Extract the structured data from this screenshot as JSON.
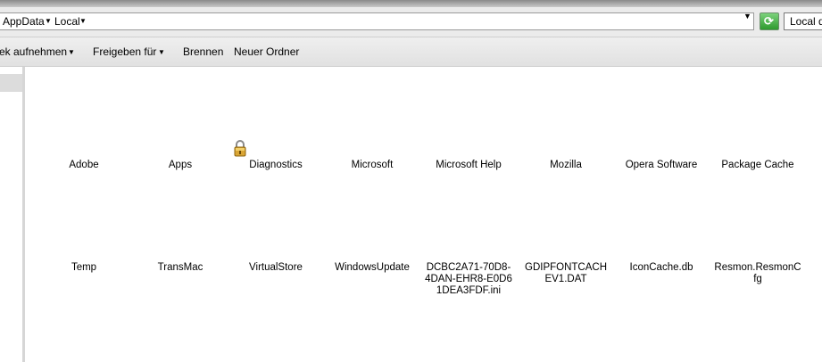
{
  "address": {
    "crumbs": [
      "AppData",
      "Local"
    ],
    "search_text": "Local du",
    "refresh_icon": "refresh-icon"
  },
  "toolbar": {
    "items": [
      {
        "label": "ek aufnehmen",
        "has_menu": true
      },
      {
        "label": "Freigeben für",
        "has_menu": true
      },
      {
        "label": "Brennen",
        "has_menu": false
      },
      {
        "label": "Neuer Ordner",
        "has_menu": false
      }
    ]
  },
  "files": {
    "row1": [
      "Adobe",
      "Apps",
      "Diagnostics",
      "Microsoft",
      "Microsoft Help",
      "Mozilla",
      "Opera Software",
      "Package Cache"
    ],
    "row2": [
      "Temp",
      "TransMac",
      "VirtualStore",
      "WindowsUpdate",
      "DCBC2A71-70D8-4DAN-EHR8-E0D61DEA3FDF.ini",
      "GDIPFONTCACHEV1.DAT",
      "IconCache.db",
      "Resmon.ResmonCfg"
    ]
  },
  "locked_item_icon": "padlock-icon"
}
